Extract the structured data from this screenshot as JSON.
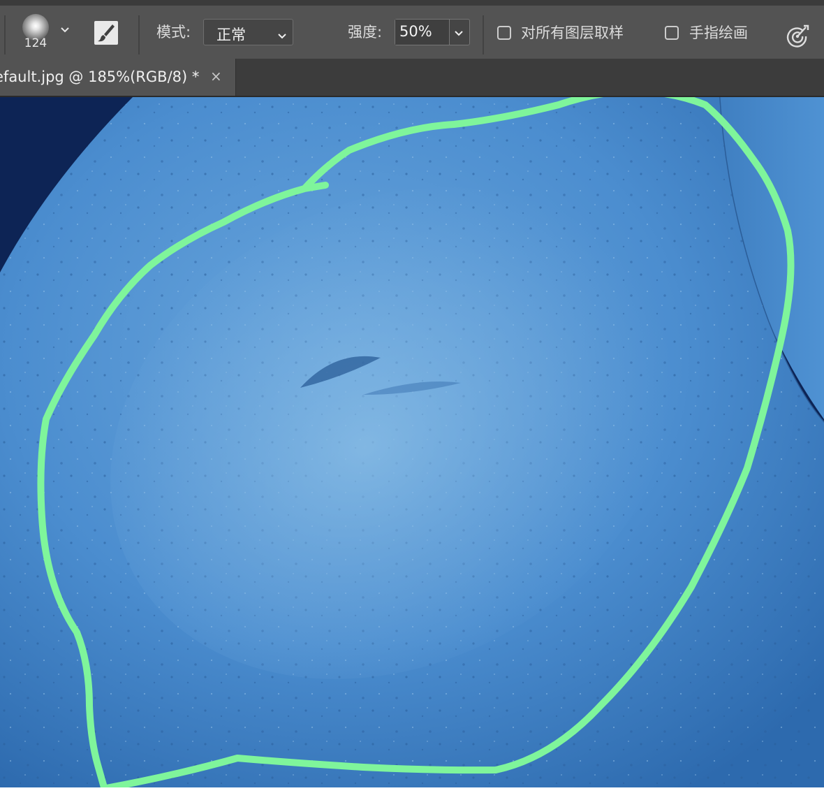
{
  "options_bar": {
    "brush_preview_icon": "soft-round-brush-icon",
    "brush_size": "124",
    "brush_panel_icon": "brush-settings-icon",
    "mode_label": "模式:",
    "mode_value": "正常",
    "strength_label": "强度:",
    "strength_value": "50%",
    "sample_all_layers_label": "对所有图层取样",
    "sample_all_layers_checked": false,
    "finger_painting_label": "手指绘画",
    "finger_painting_checked": false,
    "pressure_icon": "pressure-target-icon"
  },
  "tab": {
    "title": "efault.jpg @ 185%(RGB/8) *",
    "close_label": "×"
  },
  "canvas": {
    "annotation_color": "#7ff59b",
    "surface_color": "#4a8ed0",
    "background_color": "#0d2455"
  }
}
